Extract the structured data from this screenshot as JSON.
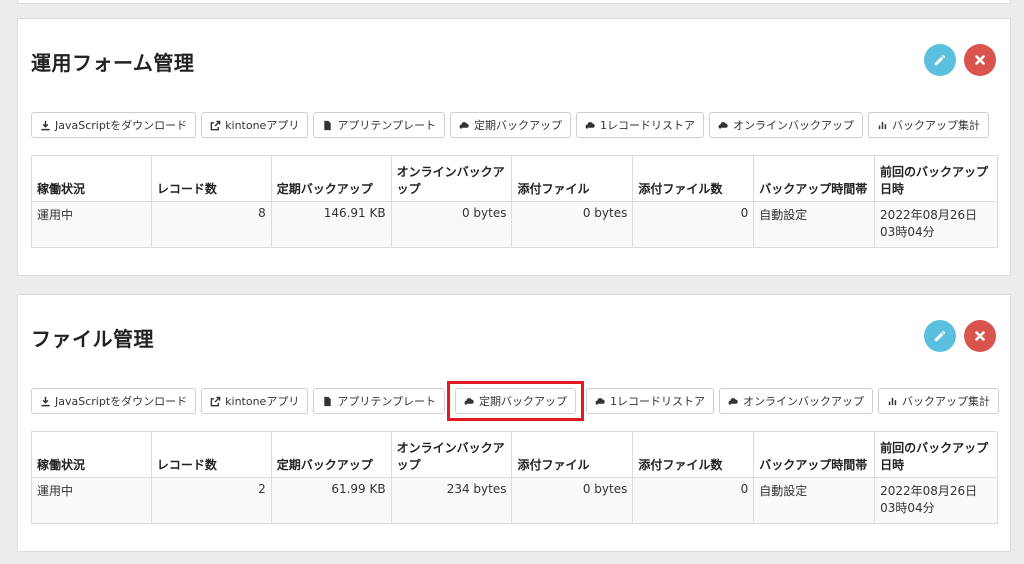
{
  "colors": {
    "edit": "#5bc0de",
    "delete": "#d9534f",
    "highlight": "#e21b23"
  },
  "toolbar": [
    {
      "icon": "download-icon",
      "label": "JavaScriptをダウンロード"
    },
    {
      "icon": "external-link-icon",
      "label": "kintoneアプリ"
    },
    {
      "icon": "file-icon",
      "label": "アプリテンプレート"
    },
    {
      "icon": "cloud-icon",
      "label": "定期バックアップ"
    },
    {
      "icon": "cloud-icon",
      "label": "1レコードリストア"
    },
    {
      "icon": "cloud-icon",
      "label": "オンラインバックアップ"
    },
    {
      "icon": "bar-chart-icon",
      "label": "バックアップ集計"
    }
  ],
  "columns": [
    "稼働状況",
    "レコード数",
    "定期バックアップ",
    "オンラインバックアップ",
    "添付ファイル",
    "添付ファイル数",
    "バックアップ時間帯",
    "前回のバックアップ日時"
  ],
  "apps": [
    {
      "title": "運用フォーム管理",
      "row": [
        "運用中",
        "8",
        "146.91 KB",
        "0 bytes",
        "0 bytes",
        "0",
        "自動設定",
        "2022年08月26日 03時04分"
      ]
    },
    {
      "title": "ファイル管理",
      "row": [
        "運用中",
        "2",
        "61.99 KB",
        "234 bytes",
        "0 bytes",
        "0",
        "自動設定",
        "2022年08月26日 03時04分"
      ]
    }
  ]
}
